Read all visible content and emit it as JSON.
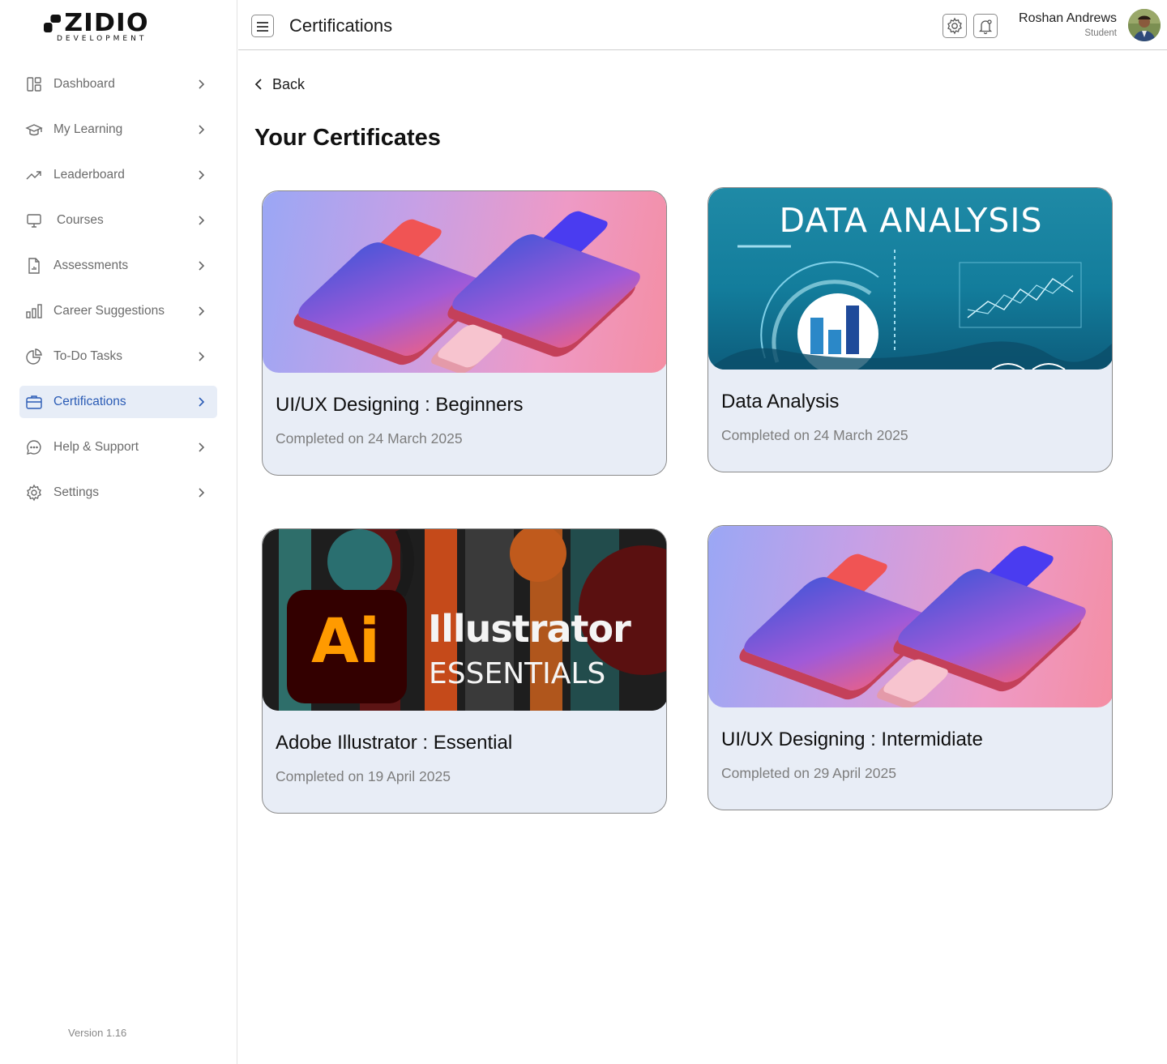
{
  "app": {
    "logo_main": "ZIDIO",
    "logo_sub": "DEVELOPMENT",
    "version": "Version 1.16"
  },
  "sidebar": {
    "items": [
      {
        "label": "Dashboard",
        "icon": "dashboard-icon"
      },
      {
        "label": "My Learning",
        "icon": "graduation-cap-icon"
      },
      {
        "label": "Leaderboard",
        "icon": "trending-up-icon"
      },
      {
        "label": "Courses",
        "icon": "monitor-icon"
      },
      {
        "label": "Assessments",
        "icon": "document-chart-icon"
      },
      {
        "label": "Career Suggestions",
        "icon": "bar-chart-icon"
      },
      {
        "label": "To-Do Tasks",
        "icon": "pie-chart-icon"
      },
      {
        "label": "Certifications",
        "icon": "briefcase-icon",
        "active": true
      },
      {
        "label": "Help & Support",
        "icon": "chat-bubble-icon"
      },
      {
        "label": "Settings",
        "icon": "gear-icon"
      }
    ]
  },
  "header": {
    "title": "Certifications",
    "user_name": "Roshan Andrews",
    "user_role": "Student"
  },
  "main": {
    "back_label": "Back",
    "section_title": "Your Certificates",
    "certificates": [
      {
        "title": "UI/UX Designing : Beginners",
        "completed": "Completed on 24 March 2025"
      },
      {
        "title": "Data Analysis",
        "completed": "Completed on 24 March 2025",
        "image_text": "DATA ANALYSIS"
      },
      {
        "title": "Adobe Illustrator : Essential",
        "completed": "Completed on 19 April 2025",
        "image_text_logo": "Ai",
        "image_text_1": "Illustrator",
        "image_text_2": "ESSENTIALS"
      },
      {
        "title": "UI/UX Designing : Intermidiate",
        "completed": "Completed on 29 April 2025"
      }
    ]
  },
  "colors": {
    "accent": "#2a5bb5",
    "active_bg": "#e7edf7",
    "card_bg": "#e8edf6"
  }
}
